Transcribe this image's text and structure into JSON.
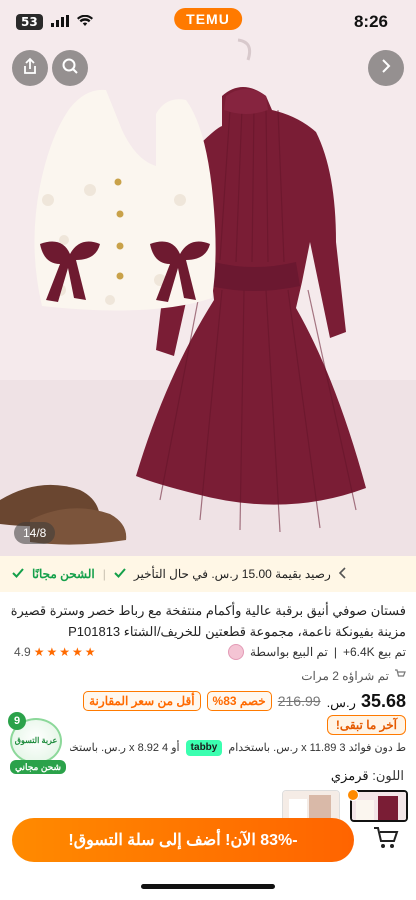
{
  "status_bar": {
    "sim": "53",
    "brand": "TEMU",
    "time": "8:26"
  },
  "gallery": {
    "counter": "14/8"
  },
  "shipping": {
    "free_shipping": "الشحن مجانًا",
    "credit": "رصيد بقيمة 15.00 ر.س. في حال التأخير"
  },
  "product": {
    "title": "فستان صوفي أنيق برقبة عالية وأكمام منتفخة مع رباط خصر وسترة قصيرة مزينة بفيونكة ناعمة، مجموعة قطعتين للخريف/الشتاء P101813",
    "rating": "4.9",
    "sold": "تم بيع 6.4K+",
    "seller_prefix": "تم البيع بواسطة",
    "bought": "تم شراؤه 2 مرات",
    "price_currency": "ر.س.",
    "price_value": "35.68",
    "old_price": "216.99",
    "discount_tag": "خصم 83%",
    "compare_tag": "أقل من سعر المقارنة",
    "last_chance": "آخر ما تبقى!",
    "installments_prefix": "ط دون فوائد 3 x 11.89 ر.س. باستخدام",
    "tabby": "tabby",
    "installments_suffix": "أو 4 x 8.92 ر.س. باستخدا",
    "color_label": "اللون:",
    "color_value": "قرمزي"
  },
  "promo": {
    "count": "9",
    "label": "عربة التسوق",
    "free": "شحن مجاني"
  },
  "cta": {
    "label": "-83% الآن! أضف إلى سلة التسوق!"
  },
  "icons": {
    "share": "share-icon",
    "search": "search-icon",
    "next": "chevron-right-icon",
    "cart": "cart-icon"
  },
  "colors": {
    "accent": "#ff7a00",
    "dress": "#7a1d35",
    "green": "#14a04a"
  }
}
